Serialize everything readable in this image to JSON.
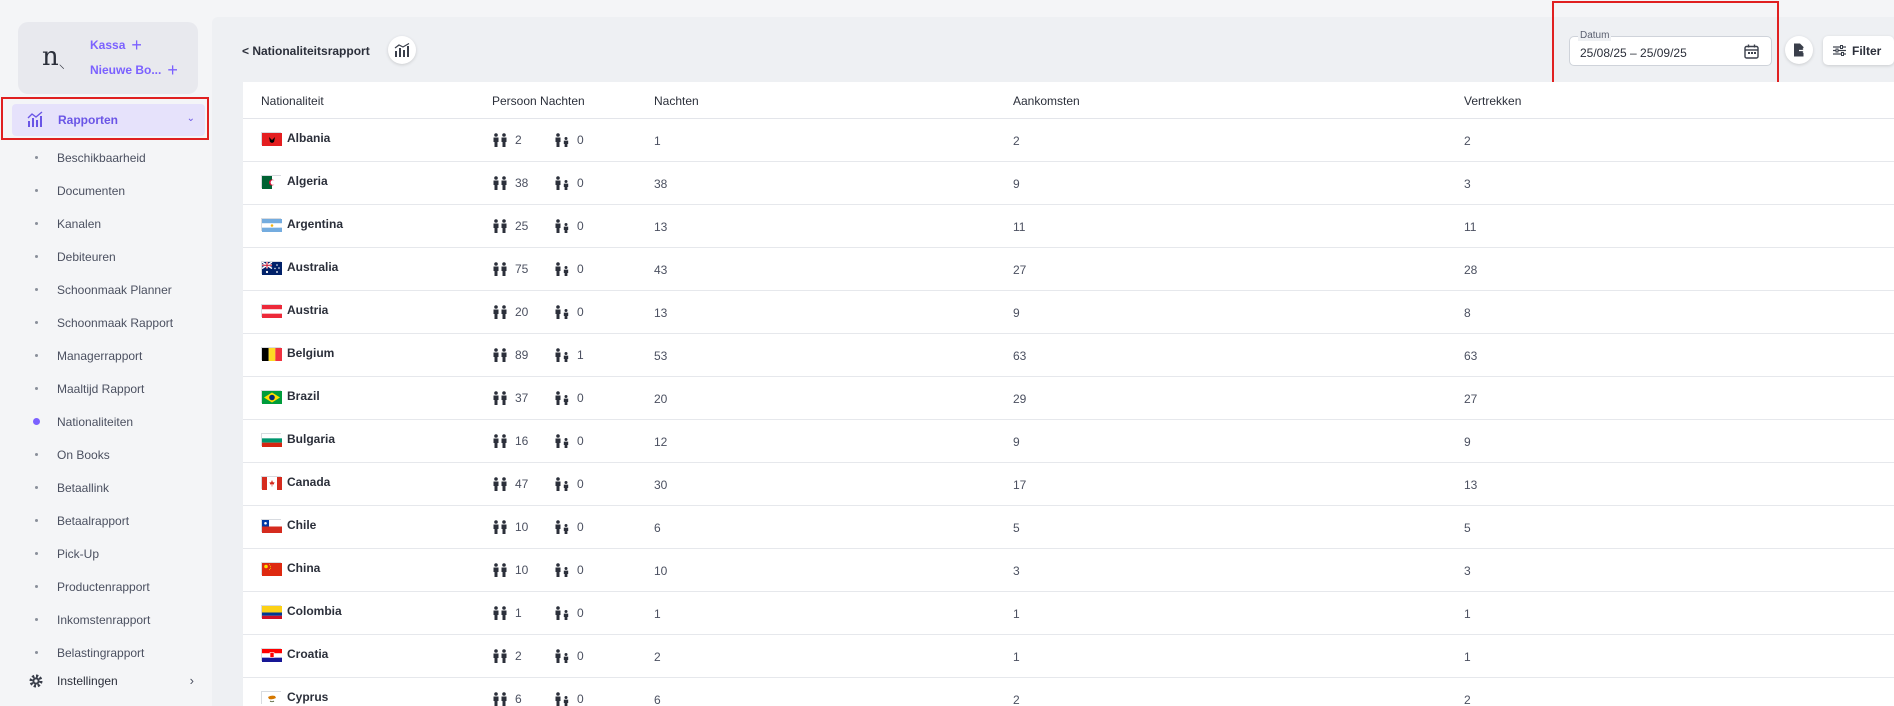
{
  "brand": {
    "logo": "n",
    "logo_suffix": "⸜",
    "links": [
      "Kassa",
      "Nieuwe Bo..."
    ]
  },
  "sidebar": {
    "reports_label": "Rapporten",
    "items": [
      {
        "label": "Beschikbaarheid",
        "active": false
      },
      {
        "label": "Documenten",
        "active": false
      },
      {
        "label": "Kanalen",
        "active": false
      },
      {
        "label": "Debiteuren",
        "active": false
      },
      {
        "label": "Schoonmaak Planner",
        "active": false
      },
      {
        "label": "Schoonmaak Rapport",
        "active": false
      },
      {
        "label": "Managerrapport",
        "active": false
      },
      {
        "label": "Maaltijd Rapport",
        "active": false
      },
      {
        "label": "Nationaliteiten",
        "active": true
      },
      {
        "label": "On Books",
        "active": false
      },
      {
        "label": "Betaallink",
        "active": false
      },
      {
        "label": "Betaalrapport",
        "active": false
      },
      {
        "label": "Pick-Up",
        "active": false
      },
      {
        "label": "Productenrapport",
        "active": false
      },
      {
        "label": "Inkomstenrapport",
        "active": false
      },
      {
        "label": "Belastingrapport",
        "active": false
      }
    ],
    "settings_label": "Instellingen"
  },
  "header": {
    "back_label": "< Nationaliteitsrapport",
    "date_label": "Datum",
    "date_value": "25/08/25 – 25/09/25",
    "filter_label": "Filter"
  },
  "table": {
    "columns": [
      "Nationaliteit",
      "Persoon Nachten",
      "Nachten",
      "Aankomsten",
      "Vertrekken"
    ],
    "rows": [
      {
        "country": "Albania",
        "flag": "albania",
        "adults": "2",
        "children": "0",
        "nights": "1",
        "arrivals": "2",
        "departures": "2"
      },
      {
        "country": "Algeria",
        "flag": "algeria",
        "adults": "38",
        "children": "0",
        "nights": "38",
        "arrivals": "9",
        "departures": "3"
      },
      {
        "country": "Argentina",
        "flag": "argentina",
        "adults": "25",
        "children": "0",
        "nights": "13",
        "arrivals": "11",
        "departures": "11"
      },
      {
        "country": "Australia",
        "flag": "australia",
        "adults": "75",
        "children": "0",
        "nights": "43",
        "arrivals": "27",
        "departures": "28"
      },
      {
        "country": "Austria",
        "flag": "austria",
        "adults": "20",
        "children": "0",
        "nights": "13",
        "arrivals": "9",
        "departures": "8"
      },
      {
        "country": "Belgium",
        "flag": "belgium",
        "adults": "89",
        "children": "1",
        "nights": "53",
        "arrivals": "63",
        "departures": "63"
      },
      {
        "country": "Brazil",
        "flag": "brazil",
        "adults": "37",
        "children": "0",
        "nights": "20",
        "arrivals": "29",
        "departures": "27"
      },
      {
        "country": "Bulgaria",
        "flag": "bulgaria",
        "adults": "16",
        "children": "0",
        "nights": "12",
        "arrivals": "9",
        "departures": "9"
      },
      {
        "country": "Canada",
        "flag": "canada",
        "adults": "47",
        "children": "0",
        "nights": "30",
        "arrivals": "17",
        "departures": "13"
      },
      {
        "country": "Chile",
        "flag": "chile",
        "adults": "10",
        "children": "0",
        "nights": "6",
        "arrivals": "5",
        "departures": "5"
      },
      {
        "country": "China",
        "flag": "china",
        "adults": "10",
        "children": "0",
        "nights": "10",
        "arrivals": "3",
        "departures": "3"
      },
      {
        "country": "Colombia",
        "flag": "colombia",
        "adults": "1",
        "children": "0",
        "nights": "1",
        "arrivals": "1",
        "departures": "1"
      },
      {
        "country": "Croatia",
        "flag": "croatia",
        "adults": "2",
        "children": "0",
        "nights": "2",
        "arrivals": "1",
        "departures": "1"
      },
      {
        "country": "Cyprus",
        "flag": "cyprus",
        "adults": "6",
        "children": "0",
        "nights": "6",
        "arrivals": "2",
        "departures": "2"
      }
    ]
  },
  "colors": {
    "accent": "#7b61ff",
    "highlight": "#e02020",
    "nav_active_bg": "#e6e2fb"
  }
}
